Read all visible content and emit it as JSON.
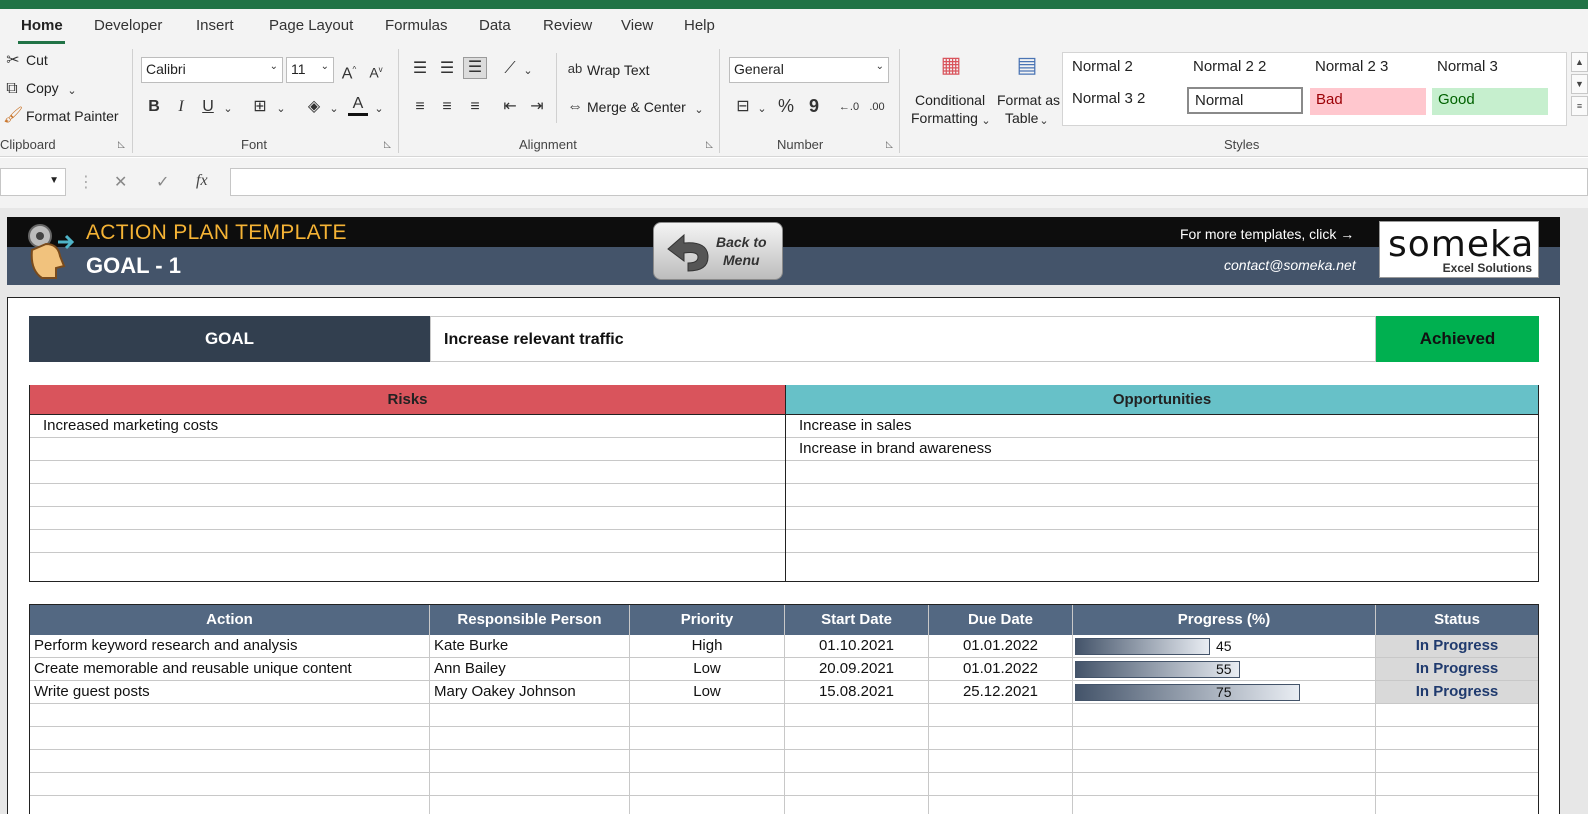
{
  "ribbon": {
    "tabs": [
      "Home",
      "Developer",
      "Insert",
      "Page Layout",
      "Formulas",
      "Data",
      "Review",
      "View",
      "Help"
    ],
    "clipboard": {
      "cut": "Cut",
      "copy": "Copy",
      "format_painter": "Format Painter",
      "label": "Clipboard"
    },
    "font": {
      "name": "Calibri",
      "size": "11",
      "label": "Font",
      "bold": "B",
      "italic": "I",
      "underline": "U"
    },
    "alignment": {
      "wrap_text": "Wrap Text",
      "merge_center": "Merge & Center",
      "label": "Alignment"
    },
    "number": {
      "format": "General",
      "label": "Number",
      "percent": "%",
      "comma": "9"
    },
    "styles": {
      "conditional": "Conditional",
      "conditional2": "Formatting",
      "format_as": "Format as",
      "format_as2": "Table",
      "cells": [
        "Normal 2",
        "Normal 2 2",
        "Normal 2 3",
        "Normal 3",
        "Normal 3 2",
        "Normal",
        "Bad",
        "Good"
      ],
      "label": "Styles"
    }
  },
  "formula_bar": {
    "fx": "fx",
    "value": ""
  },
  "banner": {
    "title": "ACTION PLAN TEMPLATE",
    "goal": "GOAL - 1",
    "back_line1": "Back to",
    "back_line2": "Menu",
    "more": "For more templates, click →",
    "contact": "contact@someka.net",
    "logo": "someka",
    "logo_sub": "Excel Solutions"
  },
  "goal": {
    "label": "GOAL",
    "text": "Increase relevant traffic",
    "status": "Achieved"
  },
  "risks": {
    "header": "Risks",
    "items": [
      "Increased marketing costs",
      "",
      "",
      "",
      "",
      "",
      ""
    ]
  },
  "opportunities": {
    "header": "Opportunities",
    "items": [
      "Increase in sales",
      "Increase in brand awareness",
      "",
      "",
      "",
      "",
      ""
    ]
  },
  "actions": {
    "headers": [
      "Action",
      "Responsible Person",
      "Priority",
      "Start Date",
      "Due Date",
      "Progress (%)",
      "Status"
    ],
    "rows": [
      {
        "action": "Perform keyword research and analysis",
        "person": "Kate Burke",
        "priority": "High",
        "start": "01.10.2021",
        "due": "01.01.2022",
        "progress": 45,
        "status": "In Progress"
      },
      {
        "action": "Create memorable and reusable unique content",
        "person": "Ann Bailey",
        "priority": "Low",
        "start": "20.09.2021",
        "due": "01.01.2022",
        "progress": 55,
        "status": "In Progress"
      },
      {
        "action": "Write guest posts",
        "person": "Mary Oakey Johnson",
        "priority": "Low",
        "start": "15.08.2021",
        "due": "25.12.2021",
        "progress": 75,
        "status": "In Progress"
      }
    ]
  },
  "colors": {
    "excel_green": "#217346",
    "banner_dark": "#0d0d0d",
    "banner_slate": "#44546a",
    "title_orange": "#f5b335",
    "goal_dark": "#323f4f",
    "achieved_green": "#00b050",
    "risks_red": "#d9545c",
    "opps_teal": "#67c1c8",
    "table_header": "#536882",
    "status_text": "#1f3a6e"
  }
}
